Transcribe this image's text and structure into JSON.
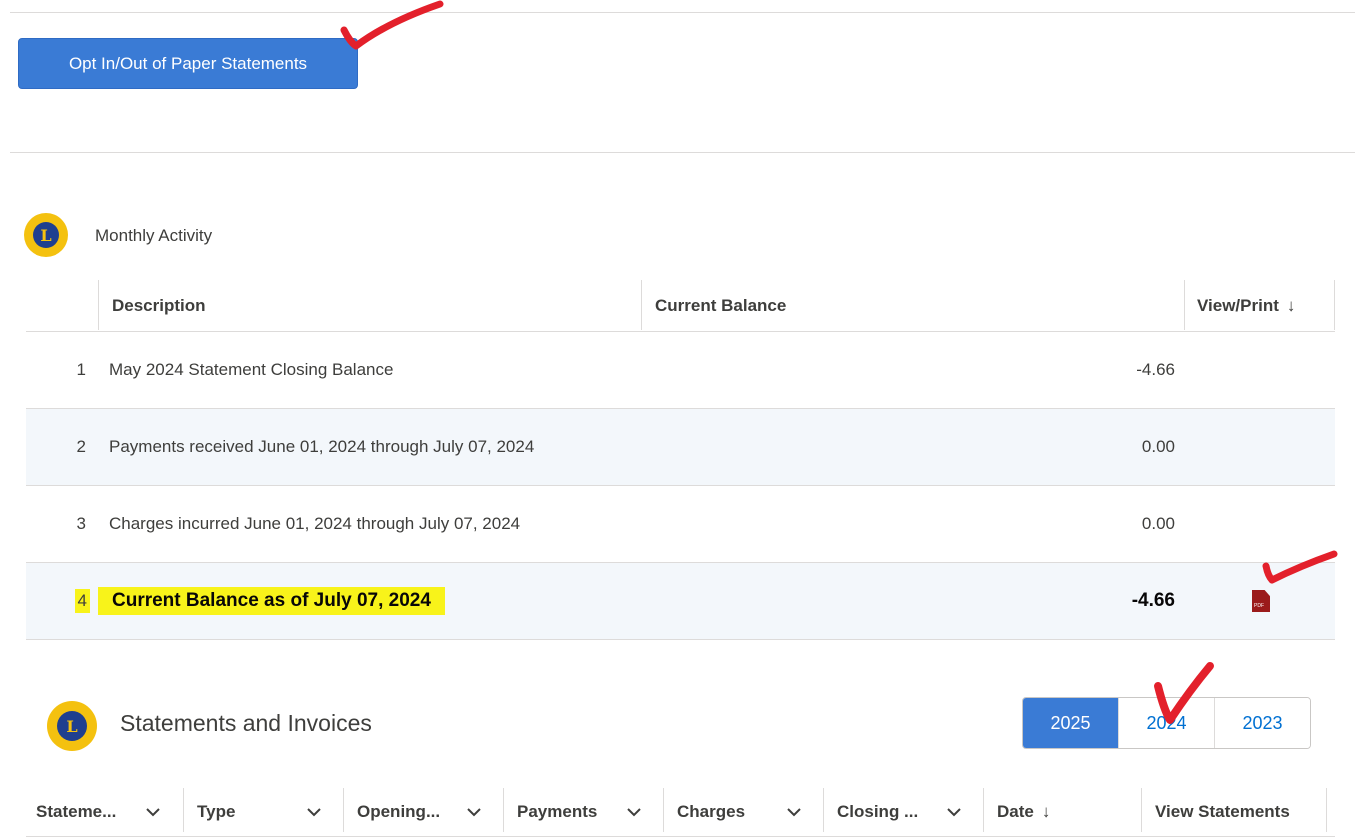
{
  "paper_statements_button": "Opt In/Out of Paper Statements",
  "monthly_activity": {
    "title": "Monthly Activity",
    "columns": [
      "Description",
      "Current Balance",
      "View/Print"
    ],
    "sort_indicator": "↓",
    "rows": [
      {
        "num": "1",
        "description": "May 2024 Statement Closing Balance",
        "balance": "-4.66"
      },
      {
        "num": "2",
        "description": "Payments received June 01, 2024 through July 07, 2024",
        "balance": "0.00"
      },
      {
        "num": "3",
        "description": "Charges incurred June 01, 2024 through July 07, 2024",
        "balance": "0.00"
      },
      {
        "num": "4",
        "description": "Current Balance as of July 07, 2024",
        "balance": "-4.66"
      }
    ]
  },
  "statements": {
    "title": "Statements and Invoices",
    "years": [
      "2025",
      "2024",
      "2023"
    ],
    "selected_year": "2025",
    "columns": [
      "Stateme...",
      "Type",
      "Opening...",
      "Payments",
      "Charges",
      "Closing ...",
      "Date",
      "View Statements"
    ],
    "date_sort_indicator": "↓"
  },
  "logo_letter": "L",
  "colors": {
    "primary": "#3a7bd5",
    "highlight": "#f8f31a",
    "annotation": "#e3202b",
    "pdf": "#9b1b1b",
    "row_alt": "#f3f7fb"
  },
  "icons": [
    "checkmark-annotation-icon",
    "lions-logo-icon",
    "pdf-icon",
    "chevron-down-icon",
    "arrow-down-icon"
  ]
}
